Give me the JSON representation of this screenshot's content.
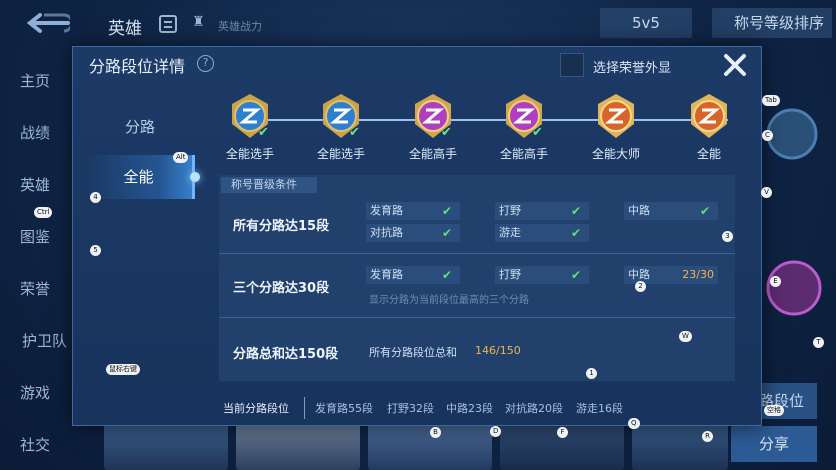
{
  "background": {
    "title": "英雄",
    "power_label": "英雄战力",
    "mode": "5v5",
    "sort": "称号等级排序",
    "sidenav": [
      "主页",
      "战绩",
      "英雄",
      "图鉴",
      "荣誉",
      "护卫队",
      "游戏",
      "社交"
    ],
    "right_rank_button": "分路段位",
    "share_button": "分享"
  },
  "modal": {
    "title": "分路段位详情",
    "honor_toggle_label": "选择荣誉外显",
    "tabs": [
      {
        "label": "分路",
        "active": false
      },
      {
        "label": "全能",
        "active": true
      }
    ],
    "ranks": [
      {
        "name": "全能选手",
        "tier": "blue",
        "achieved": true
      },
      {
        "name": "全能选手",
        "tier": "blue",
        "achieved": true
      },
      {
        "name": "全能高手",
        "tier": "purple",
        "achieved": true
      },
      {
        "name": "全能高手",
        "tier": "purple",
        "achieved": true
      },
      {
        "name": "全能大师",
        "tier": "orange",
        "achieved": false
      },
      {
        "name": "全能",
        "tier": "orange",
        "achieved": false
      }
    ],
    "conditions": {
      "header": "称号晋级条件",
      "rows": [
        {
          "title": "所有分路达15段",
          "chips": [
            {
              "label": "发育路",
              "status": "done"
            },
            {
              "label": "打野",
              "status": "done"
            },
            {
              "label": "中路",
              "status": "done"
            },
            {
              "label": "对抗路",
              "status": "done"
            },
            {
              "label": "游走",
              "status": "done"
            }
          ]
        },
        {
          "title": "三个分路达30段",
          "chips": [
            {
              "label": "发育路",
              "status": "done"
            },
            {
              "label": "打野",
              "status": "done"
            },
            {
              "label": "中路",
              "status": "progress",
              "progress": "23/30"
            }
          ],
          "note": "显示分路为当前段位最高的三个分路"
        },
        {
          "title": "分路总和达150段",
          "sum_label": "所有分路段位总和",
          "sum_value": "146/150"
        }
      ]
    },
    "footer": {
      "label": "当前分路段位",
      "items": [
        "发育路55段",
        "打野32段",
        "中路23段",
        "对抗路20段",
        "游走16段"
      ]
    }
  },
  "key_hints": [
    "Tab",
    "C",
    "V",
    "E",
    "T",
    "W",
    "Alt",
    "Ctrl",
    "4",
    "5",
    "3",
    "2",
    "1",
    "鼠标右键",
    "空格",
    "B",
    "D",
    "F",
    "Q",
    "R"
  ],
  "colors": {
    "accent": "#6fb4ff",
    "check": "#5fe07b",
    "progress": "#f0b54c",
    "modal_bg": "#1c3a66"
  }
}
